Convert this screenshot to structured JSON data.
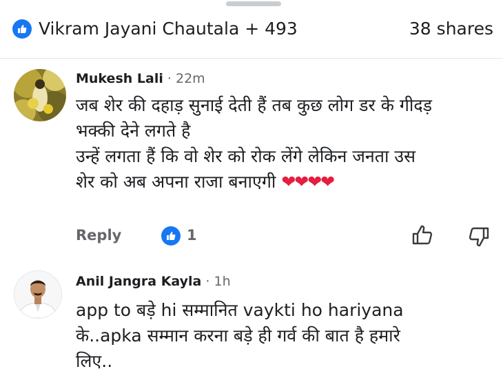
{
  "header": {
    "reactors": "Vikram Jayani Chautala + 493",
    "shares": "38 shares"
  },
  "comments": [
    {
      "author": "Mukesh Lali",
      "time": "22m",
      "lines": [
        "जब शेर की दहाड़ सुनाई देती हैं तब कुछ लोग डर के गीदड़",
        "भक्की देने लगते है",
        "उन्हें लगता हैं कि वो शेर को रोक लेंगे लेकिन जनता उस",
        "शेर को अब अपना राजा बनाएगी"
      ],
      "emoji": "❤❤❤❤",
      "reply_label": "Reply",
      "reaction_count": "1"
    },
    {
      "author": "Anil Jangra Kayla",
      "time": "1h",
      "lines": [
        "app to बड़े hi सम्मानित vaykti ho hariyana",
        "के..apka सम्मान करना बड़े ही गर्व की बात है हमारे",
        "लिए.."
      ]
    }
  ],
  "separator": "·",
  "colors": {
    "accent": "#1877f2",
    "heart": "#e41e3f",
    "muted": "#65676b"
  },
  "icons": [
    "like-icon",
    "thumb-up-icon",
    "thumb-down-icon"
  ]
}
